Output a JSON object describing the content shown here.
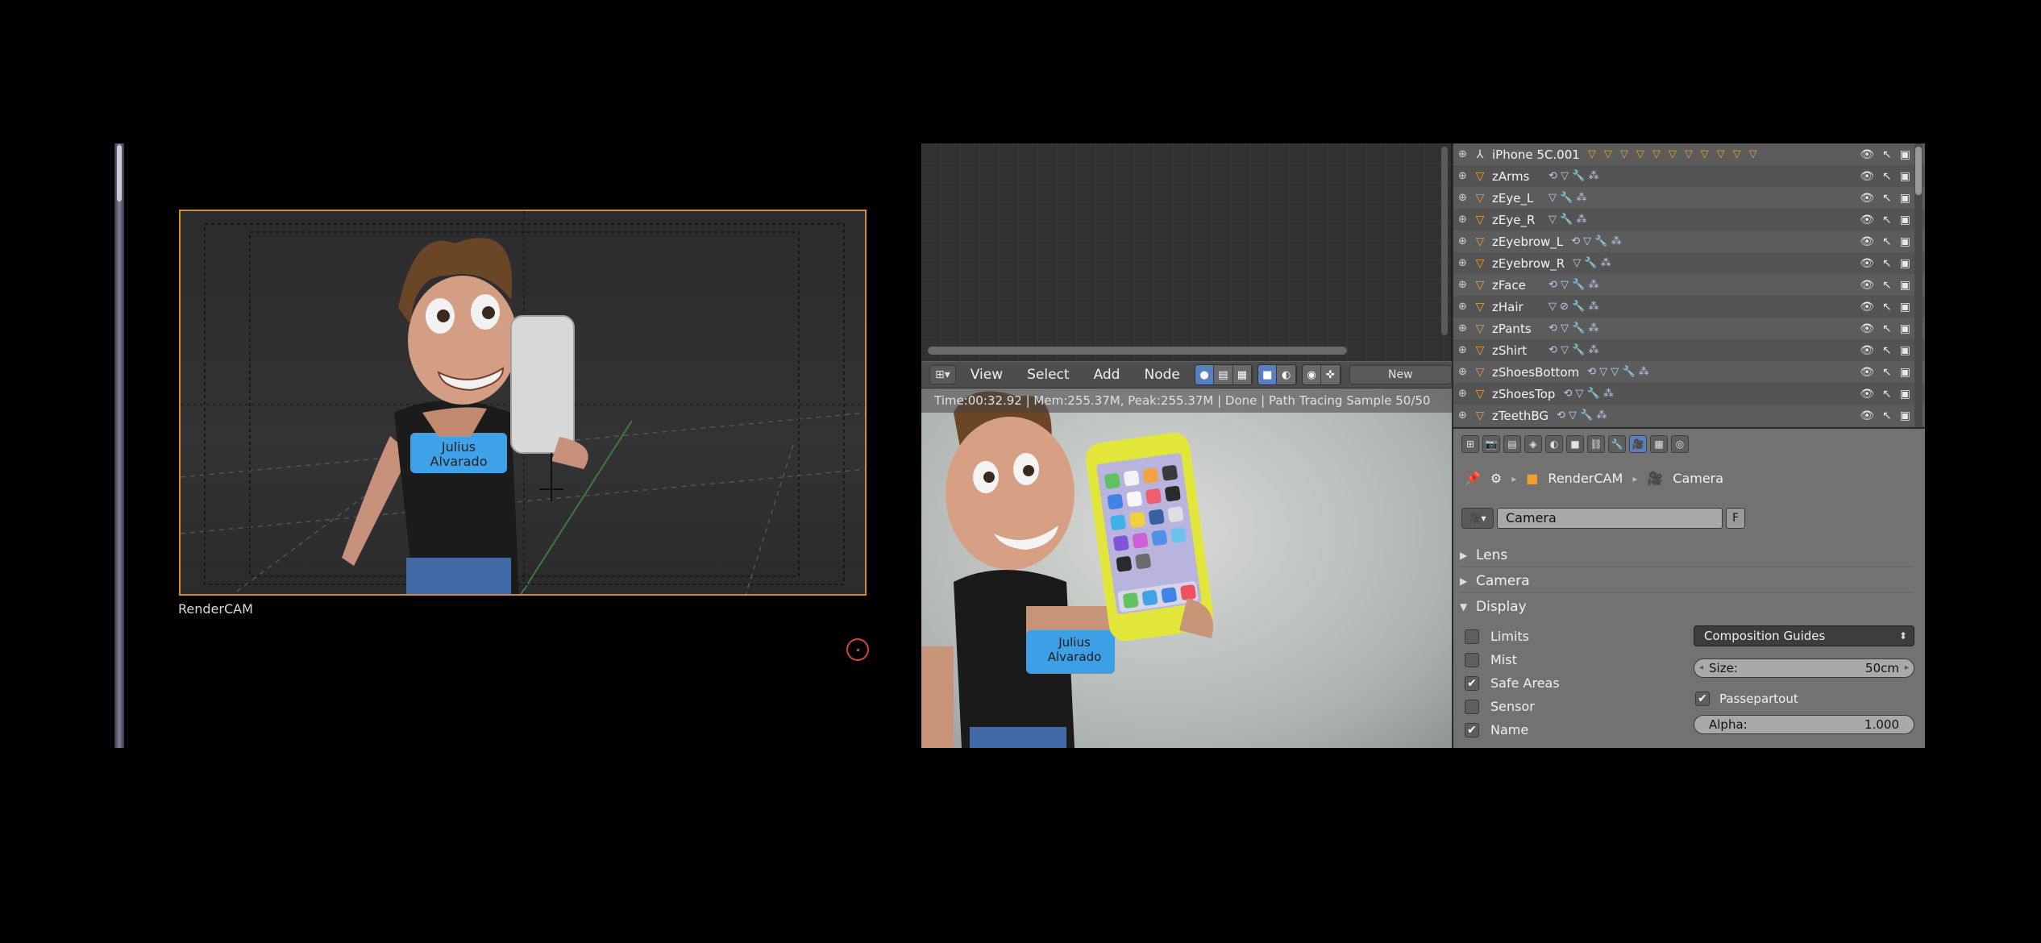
{
  "viewport": {
    "camera_label": "RenderCAM",
    "shirt_text": [
      "Julius",
      "Alvarado"
    ]
  },
  "node_editor": {
    "menus": [
      "View",
      "Select",
      "Add",
      "Node"
    ],
    "new_label": "New"
  },
  "render": {
    "status": "Time:00:32.92 | Mem:255.37M, Peak:255.37M | Done | Path Tracing Sample 50/50"
  },
  "outliner": {
    "items": [
      {
        "name": "iPhone 5C.001"
      },
      {
        "name": "zArms"
      },
      {
        "name": "zEye_L"
      },
      {
        "name": "zEye_R"
      },
      {
        "name": "zEyebrow_L"
      },
      {
        "name": "zEyebrow_R"
      },
      {
        "name": "zFace"
      },
      {
        "name": "zHair"
      },
      {
        "name": "zPants"
      },
      {
        "name": "zShirt"
      },
      {
        "name": "zShoesBottom"
      },
      {
        "name": "zShoesTop"
      },
      {
        "name": "zTeethBG"
      }
    ]
  },
  "properties": {
    "breadcrumb": {
      "object": "RenderCAM",
      "data": "Camera"
    },
    "datablock_name": "Camera",
    "fake_user": "F",
    "panels": {
      "lens": "Lens",
      "camera": "Camera",
      "display": "Display"
    },
    "checkboxes": [
      {
        "label": "Limits",
        "checked": false
      },
      {
        "label": "Mist",
        "checked": false
      },
      {
        "label": "Safe Areas",
        "checked": true
      },
      {
        "label": "Sensor",
        "checked": false
      },
      {
        "label": "Name",
        "checked": true
      }
    ],
    "composition_guides": "Composition Guides",
    "size": {
      "label": "Size:",
      "value": "50cm"
    },
    "passepartout": {
      "label": "Passepartout",
      "checked": true
    },
    "alpha": {
      "label": "Alpha:",
      "value": "1.000"
    }
  },
  "colors": {
    "camera_frame": "#d9892e",
    "accent_blue": "#5680c2",
    "cursor": "#d8423c"
  }
}
